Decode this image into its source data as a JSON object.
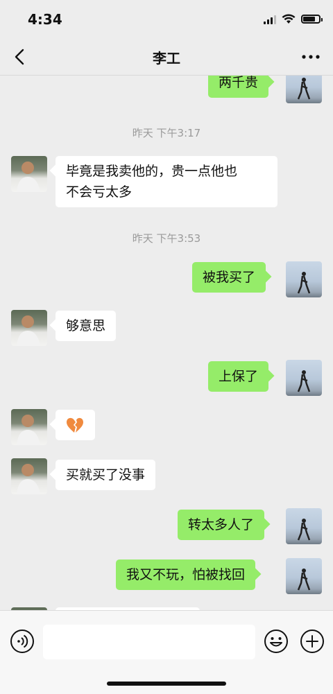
{
  "status_bar": {
    "time": "4:34"
  },
  "header": {
    "title": "李工"
  },
  "messages": [
    {
      "side": "self",
      "text": "两千贵"
    },
    {
      "type": "timestamp",
      "text": "昨天 下午3:17"
    },
    {
      "side": "other",
      "lines": [
        "毕竟是我卖他的，贵一点他也",
        "不会亏太多"
      ]
    },
    {
      "type": "timestamp",
      "text": "昨天 下午3:53"
    },
    {
      "side": "self",
      "text": "被我买了"
    },
    {
      "side": "other",
      "text": "够意思"
    },
    {
      "side": "self",
      "text": "上保了"
    },
    {
      "side": "other",
      "icon": "broken-heart-emoji"
    },
    {
      "side": "other",
      "text": "买就买了没事"
    },
    {
      "side": "self",
      "text": "转太多人了"
    },
    {
      "side": "self",
      "text": "我又不玩，怕被找回"
    },
    {
      "side": "other",
      "text": ""
    }
  ],
  "colors": {
    "background": "#ededed",
    "bubble_self": "#95ec69",
    "bubble_other": "#ffffff",
    "timestamp": "#9a9a9a"
  },
  "icons": {
    "back": "chevron-left-icon",
    "more": "more-dots-icon",
    "voice": "voice-icon",
    "emoji": "emoji-icon",
    "plus": "plus-icon"
  }
}
